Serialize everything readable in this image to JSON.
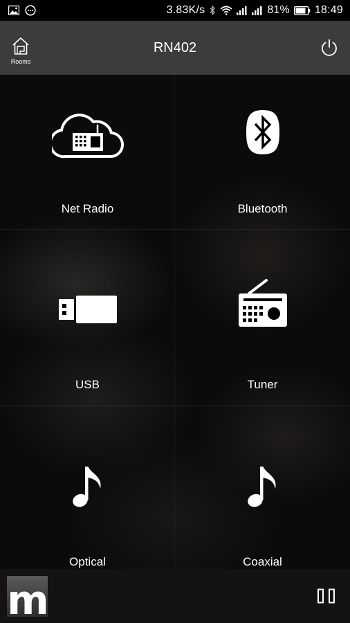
{
  "status_bar": {
    "speed": "3.83K/s",
    "battery": "81%",
    "time": "18:49",
    "icons": [
      "image-icon",
      "message-icon",
      "bluetooth-icon",
      "wifi-icon",
      "signal-icon",
      "signal-icon-2",
      "battery-icon"
    ]
  },
  "header": {
    "title": "RN402",
    "rooms_label": "Rooms",
    "background": "#3c3c3c"
  },
  "sources": [
    {
      "label": "Net Radio",
      "icon": "net-radio-cloud-icon"
    },
    {
      "label": "Bluetooth",
      "icon": "bluetooth-icon"
    },
    {
      "label": "USB",
      "icon": "usb-icon"
    },
    {
      "label": "Tuner",
      "icon": "radio-tuner-icon"
    },
    {
      "label": "Optical",
      "icon": "music-note-icon"
    },
    {
      "label": "Coaxial",
      "icon": "music-note-icon"
    }
  ],
  "player": {
    "album_art_glyph": "m",
    "control_icon": "pause-icon"
  }
}
